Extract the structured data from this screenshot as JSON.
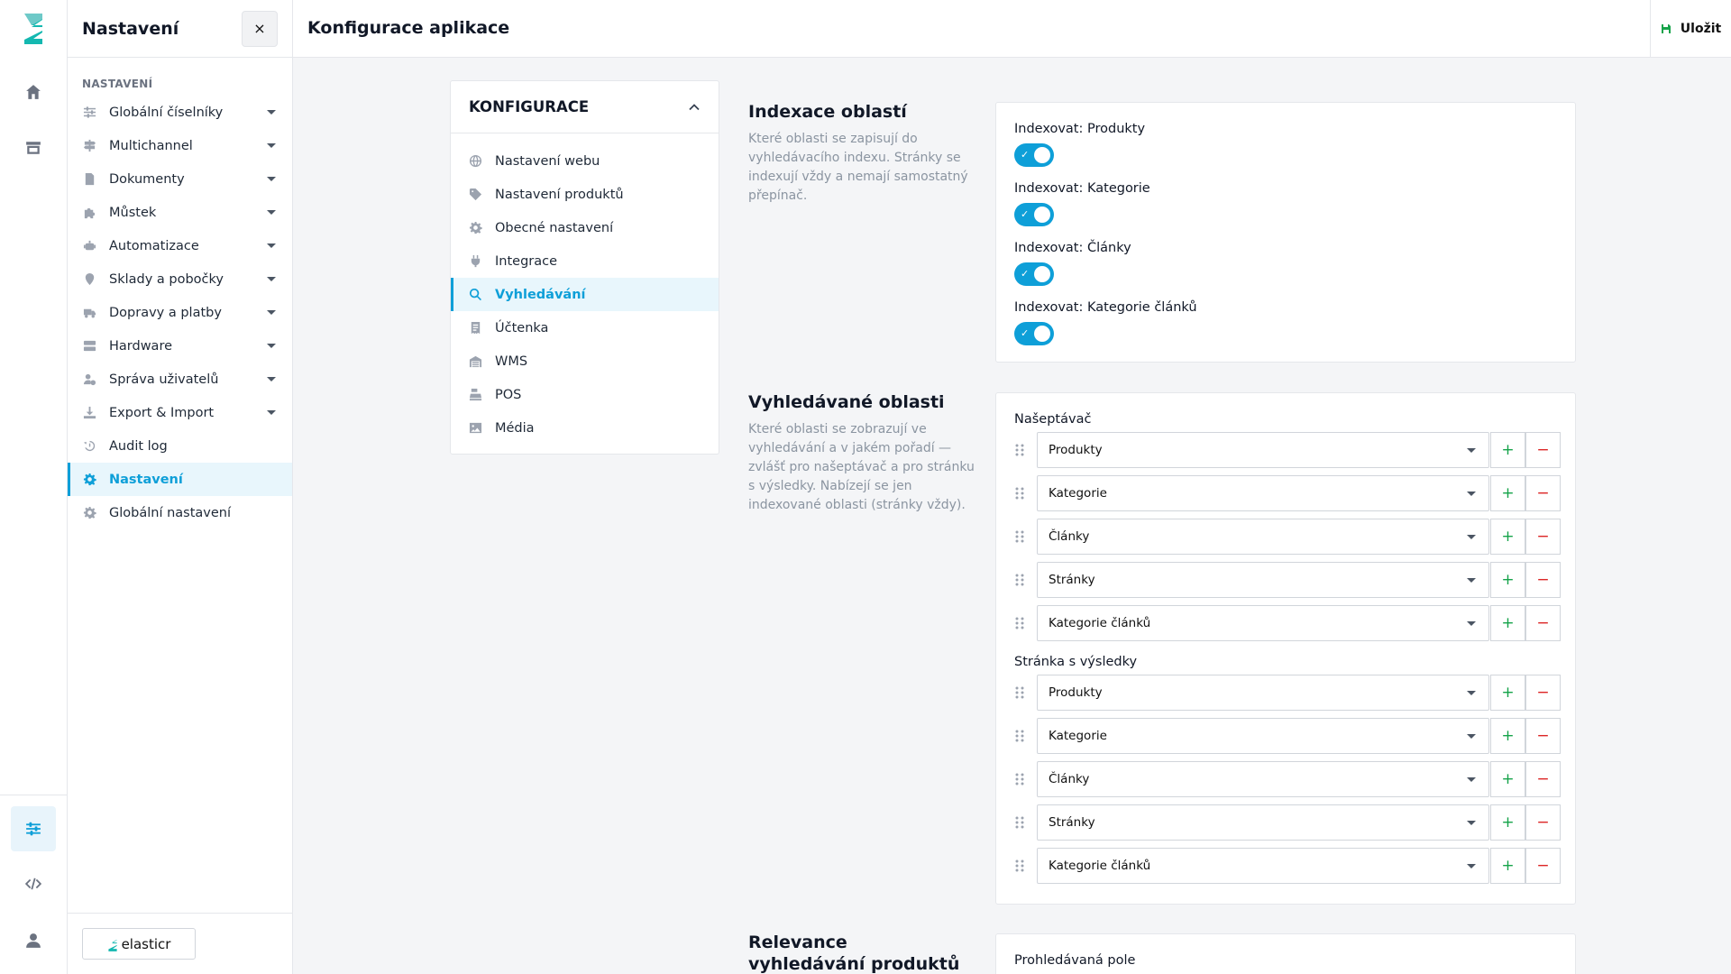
{
  "app": {
    "page_title": "Konfigurace aplikace",
    "save_label": "Uložit"
  },
  "sidebar": {
    "title": "Nastavení",
    "close_label": "×",
    "section_label": "NASTAVENÍ",
    "items": [
      {
        "label": "Globální číselníky",
        "icon": "sliders-icon",
        "expandable": true
      },
      {
        "label": "Multichannel",
        "icon": "signpost-icon",
        "expandable": true
      },
      {
        "label": "Dokumenty",
        "icon": "document-icon",
        "expandable": true
      },
      {
        "label": "Můstek",
        "icon": "puzzle-icon",
        "expandable": true
      },
      {
        "label": "Automatizace",
        "icon": "robot-icon",
        "expandable": true
      },
      {
        "label": "Sklady a pobočky",
        "icon": "location-pin-icon",
        "expandable": true
      },
      {
        "label": "Dopravy a platby",
        "icon": "truck-icon",
        "expandable": true
      },
      {
        "label": "Hardware",
        "icon": "server-icon",
        "expandable": true
      },
      {
        "label": "Správa uživatelů",
        "icon": "users-cog-icon",
        "expandable": true
      },
      {
        "label": "Export & Import",
        "icon": "download-icon",
        "expandable": true
      },
      {
        "label": "Audit log",
        "icon": "history-icon",
        "expandable": false
      },
      {
        "label": "Nastavení",
        "icon": "gear-icon",
        "expandable": false,
        "active": true
      },
      {
        "label": "Globální nastavení",
        "icon": "gear-icon",
        "expandable": false
      }
    ],
    "brand": "elasticr"
  },
  "config_nav": {
    "title": "KONFIGURACE",
    "items": [
      {
        "label": "Nastavení webu",
        "icon": "globe-icon"
      },
      {
        "label": "Nastavení produktů",
        "icon": "tag-icon"
      },
      {
        "label": "Obecné nastavení",
        "icon": "gear-icon"
      },
      {
        "label": "Integrace",
        "icon": "plug-icon"
      },
      {
        "label": "Vyhledávání",
        "icon": "search-icon",
        "active": true
      },
      {
        "label": "Účtenka",
        "icon": "receipt-icon"
      },
      {
        "label": "WMS",
        "icon": "warehouse-icon"
      },
      {
        "label": "POS",
        "icon": "cash-register-icon"
      },
      {
        "label": "Média",
        "icon": "image-icon"
      }
    ]
  },
  "indexing": {
    "title": "Indexace oblastí",
    "description": "Které oblasti se zapisují do vyhledávacího indexu. Stránky se indexují vždy a nemají samostatný přepínač.",
    "toggles": [
      {
        "label": "Indexovat: Produkty",
        "on": true
      },
      {
        "label": "Indexovat: Kategorie",
        "on": true
      },
      {
        "label": "Indexovat: Články",
        "on": true
      },
      {
        "label": "Indexovat: Kategorie článků",
        "on": true
      }
    ]
  },
  "searched": {
    "title": "Vyhledávané oblasti",
    "description": "Které oblasti se zobrazují ve vyhledávání a v jakém pořadí — zvlášť pro našeptávač a pro stránku s výsledky. Nabízejí se jen indexované oblasti (stránky vždy).",
    "groups": [
      {
        "label": "Našeptávač",
        "rows": [
          "Produkty",
          "Kategorie",
          "Články",
          "Stránky",
          "Kategorie článků"
        ]
      },
      {
        "label": "Stránka s výsledky",
        "rows": [
          "Produkty",
          "Kategorie",
          "Články",
          "Stránky",
          "Kategorie článků"
        ]
      }
    ],
    "add_label": "+",
    "remove_label": "−"
  },
  "relevance": {
    "title": "Relevance vyhledávání produktů",
    "first_label": "Prohledávaná pole"
  },
  "colors": {
    "accent": "#0e9fd8",
    "add": "#16a34a",
    "remove": "#dc2626"
  }
}
